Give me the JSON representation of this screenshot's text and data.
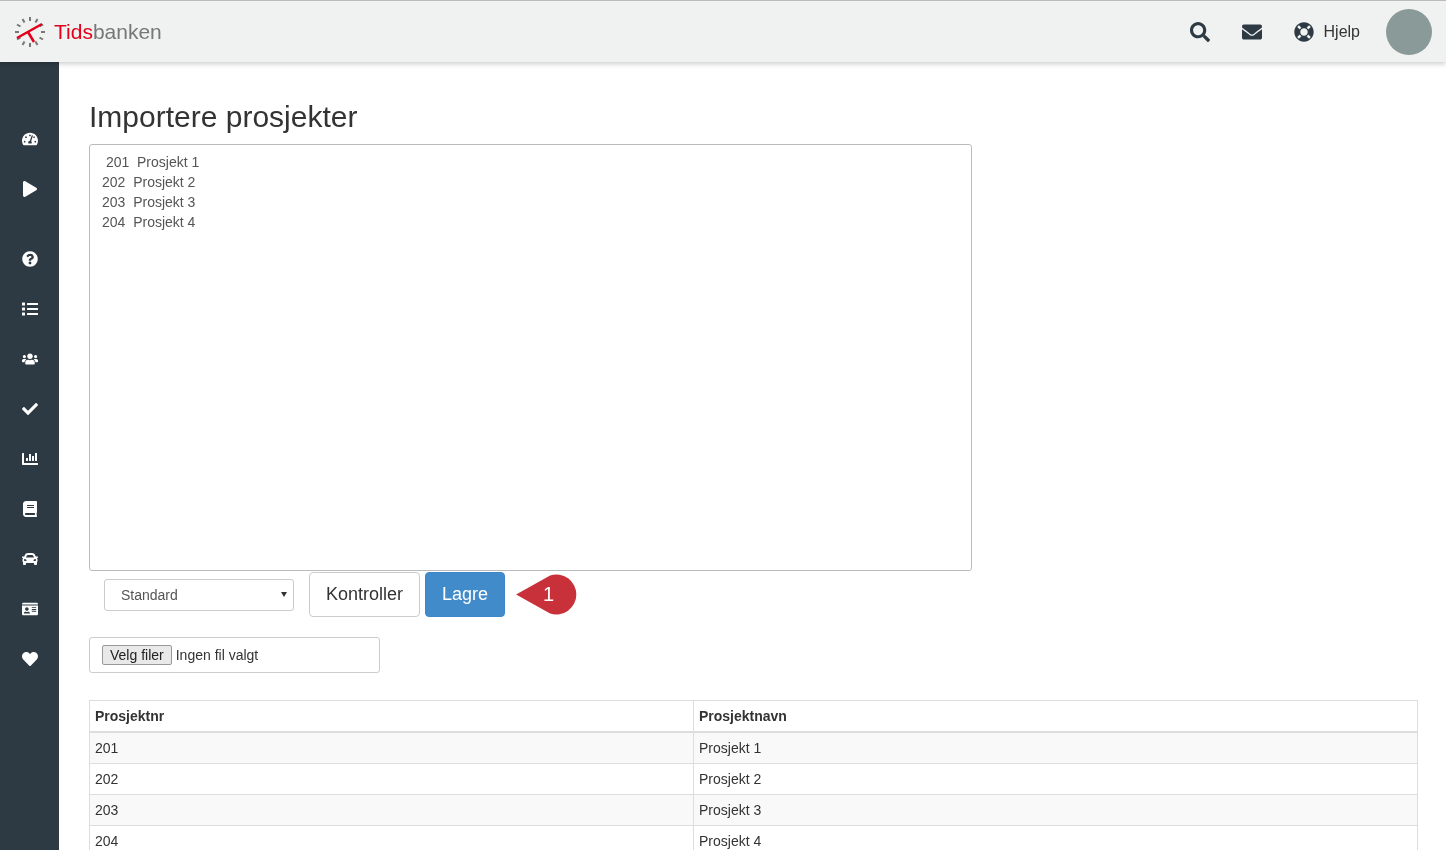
{
  "header": {
    "logo": {
      "part_1": "Tids",
      "part_2": "banken"
    },
    "help_label": "Hjelp"
  },
  "sidebar": {
    "items": [
      {
        "kind": "dashboard"
      },
      {
        "kind": "play"
      },
      {
        "kind": "help"
      },
      {
        "kind": "list"
      },
      {
        "kind": "users"
      },
      {
        "kind": "check"
      },
      {
        "kind": "chart"
      },
      {
        "kind": "book"
      },
      {
        "kind": "car"
      },
      {
        "kind": "card"
      },
      {
        "kind": "heart"
      }
    ]
  },
  "page": {
    "title": "Importere prosjekter",
    "import_text": [
      " 201  Prosjekt 1",
      "202  Prosjekt 2",
      "203  Prosjekt 3",
      "204  Prosjekt 4"
    ],
    "format_select": "Standard",
    "buttons": [
      {
        "label": "Kontroller",
        "kind": "default"
      },
      {
        "label": "Lagre",
        "kind": "primary"
      }
    ],
    "step_marker": "1",
    "file_input": {
      "button": "Velg filer",
      "status": "Ingen fil valgt"
    },
    "table": {
      "columns": [
        "Prosjektnr",
        "Prosjektnavn"
      ],
      "rows": [
        [
          "201",
          "Prosjekt 1"
        ],
        [
          "202",
          "Prosjekt 2"
        ],
        [
          "203",
          "Prosjekt 3"
        ],
        [
          "204",
          "Prosjekt 4"
        ]
      ]
    }
  }
}
